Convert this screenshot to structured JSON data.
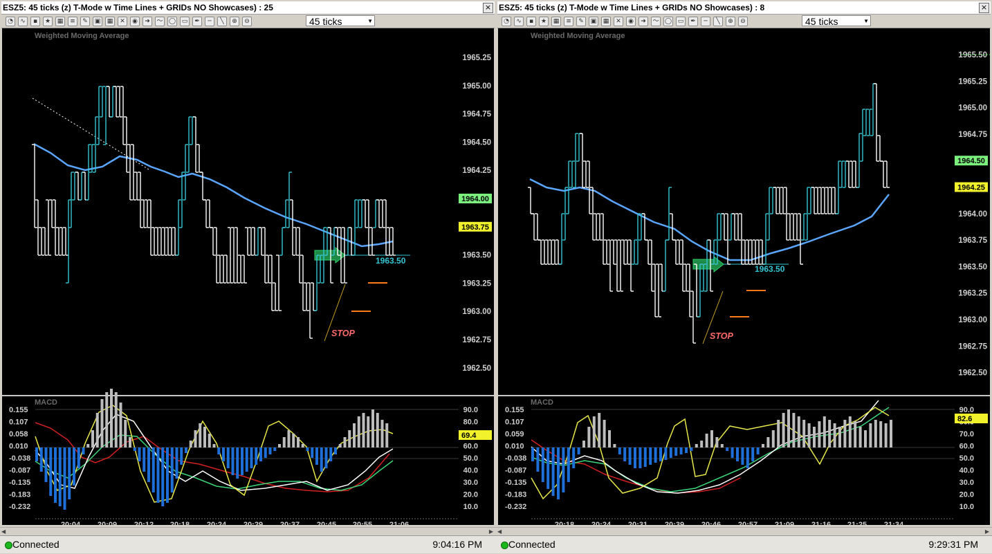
{
  "left": {
    "title": "ESZ5: 45 ticks (z) T-Mode  w Time Lines + GRIDs NO Showcases) : 25",
    "interval": "45 ticks",
    "indicator_label": "Weighted Moving Average",
    "macd_label": "MACD",
    "price_ticks": [
      "1965.25",
      "1965.00",
      "1964.75",
      "1964.50",
      "1964.25",
      "1964.00",
      "1963.75",
      "1963.50",
      "1963.25",
      "1963.00",
      "1962.75",
      "1962.50"
    ],
    "highlight_green": "1964.00",
    "highlight_yellow": "1963.75",
    "entry_label": "1963.50",
    "stop_label": "STOP",
    "macd_ticks": [
      "0.155",
      "0.107",
      "0.058",
      "0.010",
      "-0.038",
      "-0.087",
      "-0.135",
      "-0.183",
      "-0.232"
    ],
    "stoch_ticks": [
      "90.0",
      "80.0",
      "70.0",
      "60.0",
      "50.0",
      "40.0",
      "30.0",
      "20.0",
      "10.0"
    ],
    "stoch_value": "69.4",
    "time_ticks": [
      "20:04",
      "20:09",
      "20:12",
      "20:18",
      "20:24",
      "20:29",
      "20:37",
      "20:45",
      "20:55",
      "21:06"
    ],
    "status": "Connected",
    "clock": "9:04:16 PM"
  },
  "right": {
    "title": "ESZ5: 45 ticks (z) T-Mode  w Time Lines + GRIDs NO Showcases) : 8",
    "interval": "45 ticks",
    "indicator_label": "Weighted Moving Average",
    "macd_label": "MACD",
    "price_ticks": [
      "1965.50",
      "1965.25",
      "1965.00",
      "1964.75",
      "1964.50",
      "1964.25",
      "1964.00",
      "1963.75",
      "1963.50",
      "1963.25",
      "1963.00",
      "1962.75",
      "1962.50"
    ],
    "highlight_green": "1964.50",
    "highlight_yellow": "1964.25",
    "entry_label": "1963.50",
    "stop_label": "STOP",
    "macd_ticks": [
      "0.155",
      "0.107",
      "0.059",
      "0.010",
      "-0.038",
      "-0.087",
      "-0.135",
      "-0.183",
      "-0.232"
    ],
    "stoch_ticks": [
      "90.0",
      "80.0",
      "70.0",
      "60.0",
      "50.0",
      "40.0",
      "30.0",
      "20.0",
      "10.0"
    ],
    "stoch_value": "82.6",
    "time_ticks": [
      "20:18",
      "20:24",
      "20:31",
      "20:39",
      "20:46",
      "20:57",
      "21:09",
      "21:16",
      "21:25",
      "21:34"
    ],
    "status": "Connected",
    "clock": "9:29:31 PM"
  },
  "colors": {
    "up_bar": "#35c6d4",
    "down_bar": "#ffffff",
    "wma": "#5aa6ff",
    "macd_pos": "#bdbdbd",
    "macd_neg": "#1e6fd8",
    "stoch_yellow": "#e8e84a",
    "green_label": "#7cf07c",
    "yellow_label": "#f2f22c",
    "stop": "#ff6a6a",
    "orange": "#ff7a1a"
  }
}
